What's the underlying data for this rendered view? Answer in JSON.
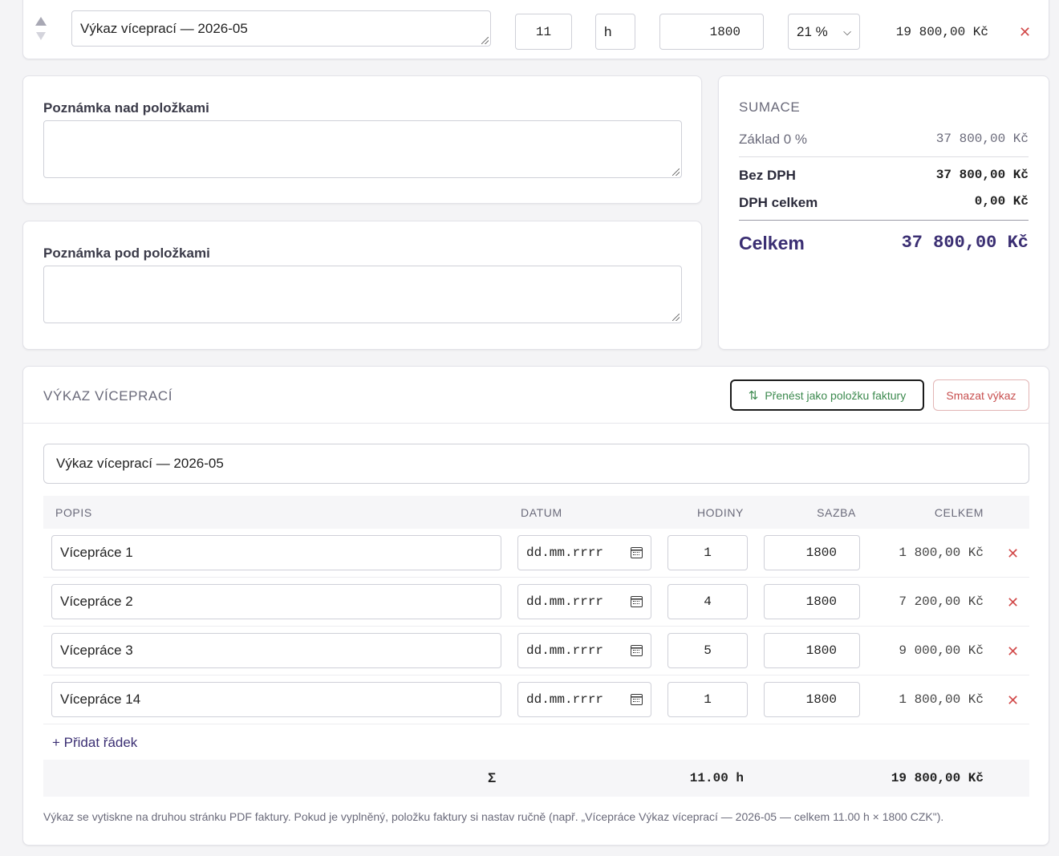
{
  "top_item": {
    "description": "Výkaz víceprací — 2026-05",
    "quantity": "11",
    "unit": "h",
    "unit_price": "1800",
    "vat": "21 %",
    "total": "19 800,00 Kč"
  },
  "note_above": {
    "label": "Poznámka nad položkami",
    "value": ""
  },
  "note_below": {
    "label": "Poznámka pod položkami",
    "value": ""
  },
  "summary": {
    "title": "SUMACE",
    "base_label": "Základ 0 %",
    "base_value": "37 800,00 Kč",
    "without_vat_label": "Bez DPH",
    "without_vat_value": "37 800,00 Kč",
    "vat_label": "DPH celkem",
    "vat_value": "0,00 Kč",
    "total_label": "Celkem",
    "total_value": "37 800,00 Kč"
  },
  "extra_work": {
    "title": "VÝKAZ VÍCEPRACÍ",
    "transfer_button": "Přenést jako položku faktury",
    "delete_button": "Smazat výkaz",
    "name_value": "Výkaz víceprací — 2026-05",
    "columns": [
      "POPIS",
      "DATUM",
      "HODINY",
      "SAZBA",
      "CELKEM"
    ],
    "rows": [
      {
        "description": "Vícepráce 1",
        "date": "dd.mm.rrrr",
        "hours": "1",
        "rate": "1800",
        "total": "1 800,00 Kč"
      },
      {
        "description": "Vícepráce 2",
        "date": "dd.mm.rrrr",
        "hours": "4",
        "rate": "1800",
        "total": "7 200,00 Kč"
      },
      {
        "description": "Vícepráce 3",
        "date": "dd.mm.rrrr",
        "hours": "5",
        "rate": "1800",
        "total": "9 000,00 Kč"
      },
      {
        "description": "Vícepráce 14",
        "date": "dd.mm.rrrr",
        "hours": "1",
        "rate": "1800",
        "total": "1 800,00 Kč"
      }
    ],
    "add_row": "+ Přidat řádek",
    "sum_symbol": "Σ",
    "sum_hours": "11.00 h",
    "sum_total": "19 800,00 Kč",
    "footnote": "Výkaz se vytiskne na druhou stránku PDF faktury. Pokud je vyplněný, položku faktury si nastav ručně (např. „Vícepráce Výkaz víceprací — 2026-05 — celkem 11.00 h × 1800 CZK\")."
  },
  "colors": {
    "accent_purple": "#3b2f73",
    "delete_red": "#d24b4b",
    "transfer_green": "#3d8a4f"
  }
}
